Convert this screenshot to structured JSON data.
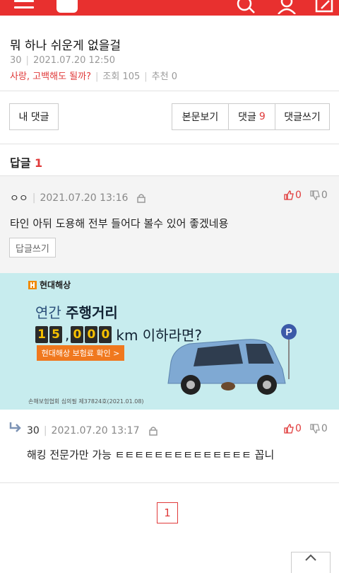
{
  "post": {
    "title": "뭐 하나 쉬운게 없을걸",
    "author": "30",
    "datetime": "2021.07.20 12:50",
    "category": "사랑, 고백해도 될까?",
    "views_label": "조회",
    "views": "105",
    "recommend_label": "추천",
    "recommend": "0"
  },
  "actions": {
    "my_comments": "내 댓글",
    "view_post": "본문보기",
    "comments_label": "댓글",
    "comments_count": "9",
    "write_comment": "댓글쓰기"
  },
  "replies": {
    "label": "답글",
    "count": "1"
  },
  "comments": [
    {
      "nick": "ㅇㅇ",
      "datetime": "2021.07.20 13:16",
      "text": "타인 아뒤 도용해 전부 들어다 볼수 있어 좋겠네용",
      "reply_button": "답글쓰기",
      "up": "0",
      "down": "0"
    },
    {
      "nick": "30",
      "datetime": "2021.07.20 13:17",
      "text": "해킹 전문가만 가능 ㅌㅌㅌㅌㅌㅌㅌㅌㅌㅌㅌㅌㅌㅌ 꼽니",
      "up": "0",
      "down": "0"
    }
  ],
  "ad": {
    "brand": "현대해상",
    "line1_prefix": "연간 ",
    "line1_bold": "주행거리",
    "digits": [
      "1",
      "5",
      "0",
      "0",
      "0"
    ],
    "line2_suffix": "km 이하라면?",
    "cta": "현대해상 보험료 확인 >",
    "footnote": "손해보험협회 심의필 제37824호(2021.01.08)",
    "parking_sign": "P"
  },
  "pagination": {
    "current": "1"
  },
  "colors": {
    "brand_red": "#e8302f",
    "accent_red": "#e03a3a",
    "ad_bg": "#c7ecee"
  }
}
